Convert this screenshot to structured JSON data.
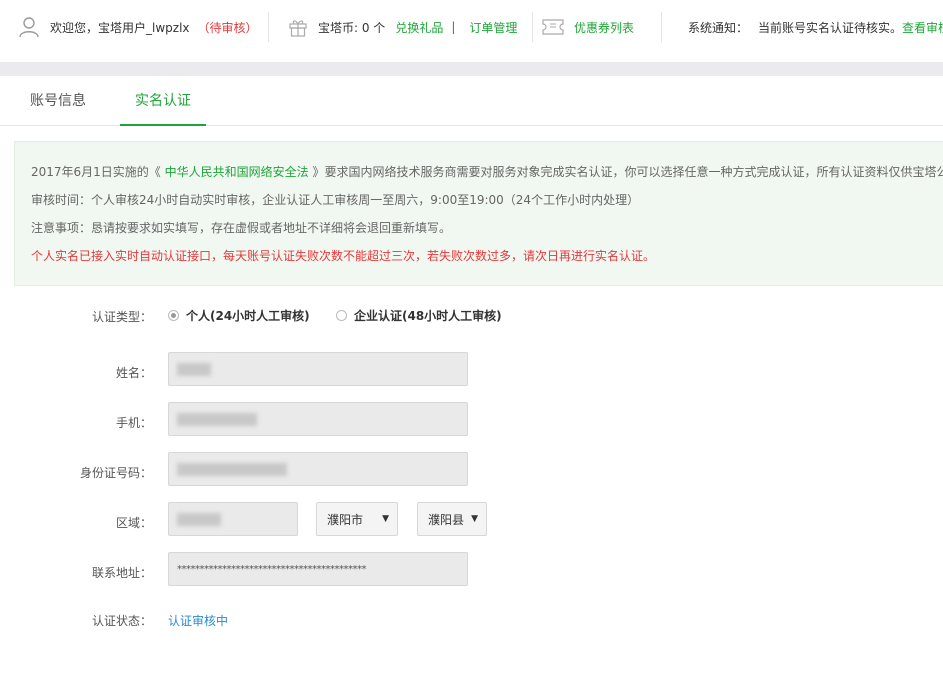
{
  "topbar": {
    "welcome_prefix": "欢迎您，宝塔用户_lwpzlx",
    "pending_badge": "（待审核）",
    "coins_label": "宝塔币: 0 个",
    "exchange_gift": "兑换礼品",
    "separator": "|",
    "order_manage": "订单管理",
    "coupon_list": "优惠券列表",
    "notice_label": "系统通知：",
    "notice_text": "当前账号实名认证待核实。",
    "notice_link": "查看审核"
  },
  "tabs": [
    {
      "label": "账号信息",
      "active": false
    },
    {
      "label": "实名认证",
      "active": true
    }
  ],
  "notice": {
    "line1_pre": "2017年6月1日实施的《 ",
    "line1_link": "中华人民共和国网络安全法",
    "line1_post": " 》要求国内网络技术服务商需要对服务对象完成实名认证，你可以选择任意一种方式完成认证，所有认证资料仅供宝塔公",
    "line2": "审核时间：个人审核24小时自动实时审核，企业认证人工审核周一至周六，9:00至19:00（24个工作小时内处理）",
    "line3": "注意事项：恳请按要求如实填写，存在虚假或者地址不详细将会退回重新填写。",
    "line4": "个人实名已接入实时自动认证接口，每天账号认证失败次数不能超过三次，若失败次数过多，请次日再进行实名认证。"
  },
  "form": {
    "type_label": "认证类型：",
    "type_options": [
      {
        "label": "个人(24小时人工审核)",
        "selected": true
      },
      {
        "label": "企业认证(48小时人工审核)",
        "selected": false
      }
    ],
    "name_label": "姓名：",
    "phone_label": "手机：",
    "id_label": "身份证号码：",
    "region_label": "区域：",
    "city_value": "濮阳市",
    "county_value": "濮阳县",
    "address_label": "联系地址：",
    "address_value": "******************************************",
    "status_label": "认证状态：",
    "status_value": "认证审核中"
  },
  "colors": {
    "brand_green": "#20a53a",
    "warning_red": "#e4393c",
    "status_blue": "#2a8ad8"
  }
}
